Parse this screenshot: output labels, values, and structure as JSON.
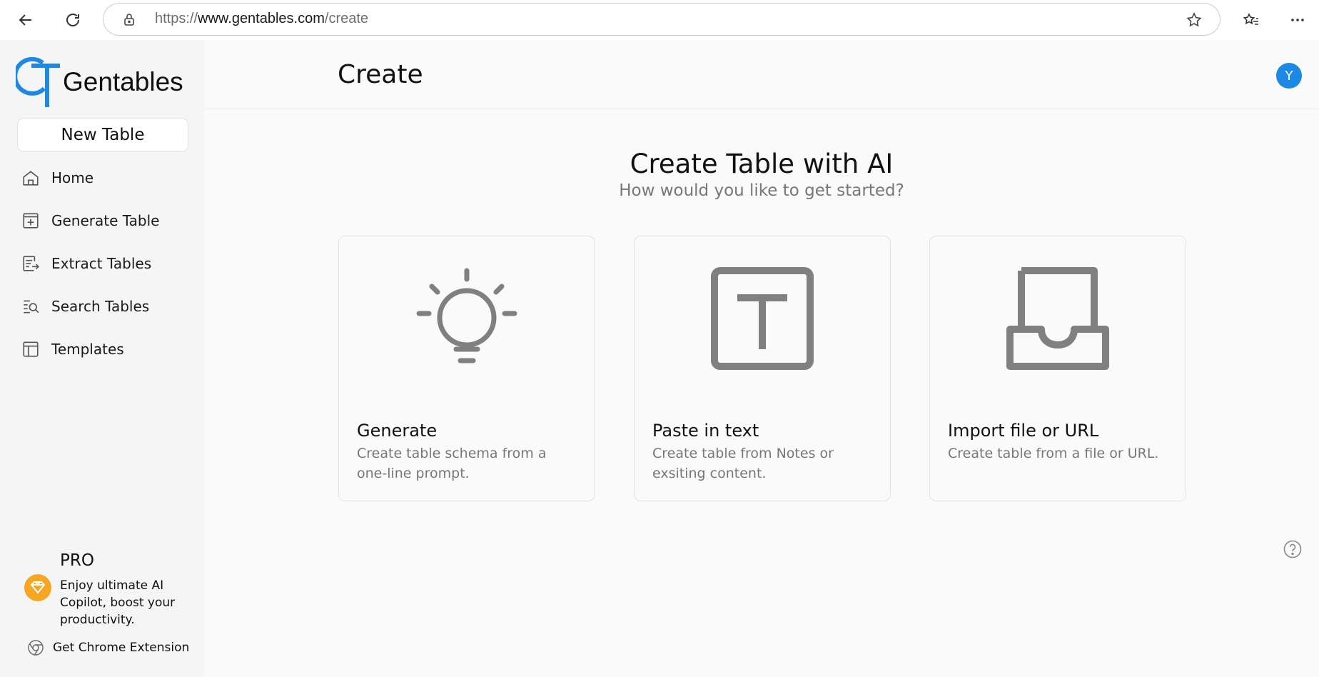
{
  "browser": {
    "url_scheme": "https://",
    "url_host": "www.gentables.com",
    "url_path": "/create"
  },
  "sidebar": {
    "logo_text": "Gentables",
    "new_table_label": "New Table",
    "items": [
      {
        "label": "Home",
        "icon": "home-icon"
      },
      {
        "label": "Generate Table",
        "icon": "plus-square-icon"
      },
      {
        "label": "Extract Tables",
        "icon": "extract-icon"
      },
      {
        "label": "Search Tables",
        "icon": "search-list-icon"
      },
      {
        "label": "Templates",
        "icon": "template-icon"
      }
    ],
    "pro": {
      "title": "PRO",
      "description": "Enjoy ultimate AI Copilot, boost your productivity."
    },
    "chrome_extension_label": "Get Chrome Extension"
  },
  "header": {
    "title": "Create",
    "avatar_initial": "Y"
  },
  "hero": {
    "title": "Create Table with AI",
    "subtitle": "How would you like to get started?"
  },
  "cards": [
    {
      "title": "Generate",
      "description": "Create table schema from a one-line prompt.",
      "icon": "lightbulb-icon"
    },
    {
      "title": "Paste in text",
      "description": "Create table from Notes or exsiting content.",
      "icon": "text-box-icon"
    },
    {
      "title": "Import file or URL",
      "description": "Create table from a file or URL.",
      "icon": "inbox-icon"
    }
  ],
  "colors": {
    "accent": "#1e88e5",
    "pro_badge": "#f5a623",
    "icon_gray": "#808080"
  }
}
